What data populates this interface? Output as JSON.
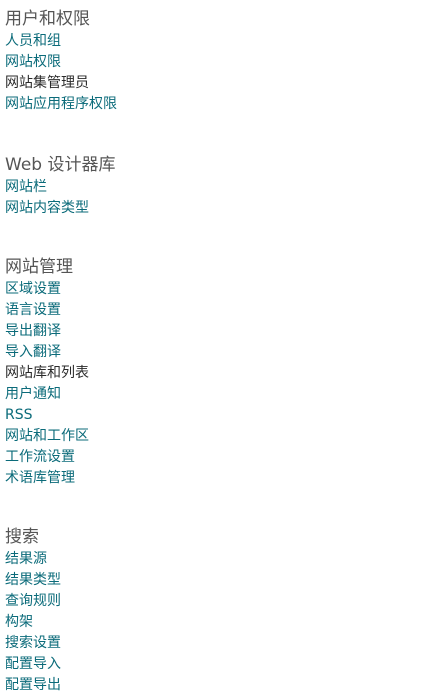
{
  "sections": [
    {
      "title": "用户和权限",
      "links": [
        {
          "label": "人员和组"
        },
        {
          "label": "网站权限"
        },
        {
          "label": "网站集管理员"
        },
        {
          "label": "网站应用程序权限"
        }
      ]
    },
    {
      "title": "Web 设计器库",
      "links": [
        {
          "label": "网站栏"
        },
        {
          "label": "网站内容类型"
        }
      ]
    },
    {
      "title": "网站管理",
      "links": [
        {
          "label": "区域设置"
        },
        {
          "label": "语言设置"
        },
        {
          "label": "导出翻译"
        },
        {
          "label": "导入翻译"
        },
        {
          "label": "网站库和列表"
        },
        {
          "label": "用户通知"
        },
        {
          "label": "RSS"
        },
        {
          "label": "网站和工作区"
        },
        {
          "label": "工作流设置"
        },
        {
          "label": "术语库管理"
        }
      ]
    },
    {
      "title": "搜索",
      "links": [
        {
          "label": "结果源"
        },
        {
          "label": "结果类型"
        },
        {
          "label": "查询规则"
        },
        {
          "label": "构架"
        },
        {
          "label": "搜索设置"
        },
        {
          "label": "配置导入"
        },
        {
          "label": "配置导出"
        }
      ]
    }
  ],
  "colors": {
    "link": "#0b6b7a",
    "link_dark": "#2b2b2b",
    "section_title": "#555555",
    "background": "#ffffff"
  }
}
